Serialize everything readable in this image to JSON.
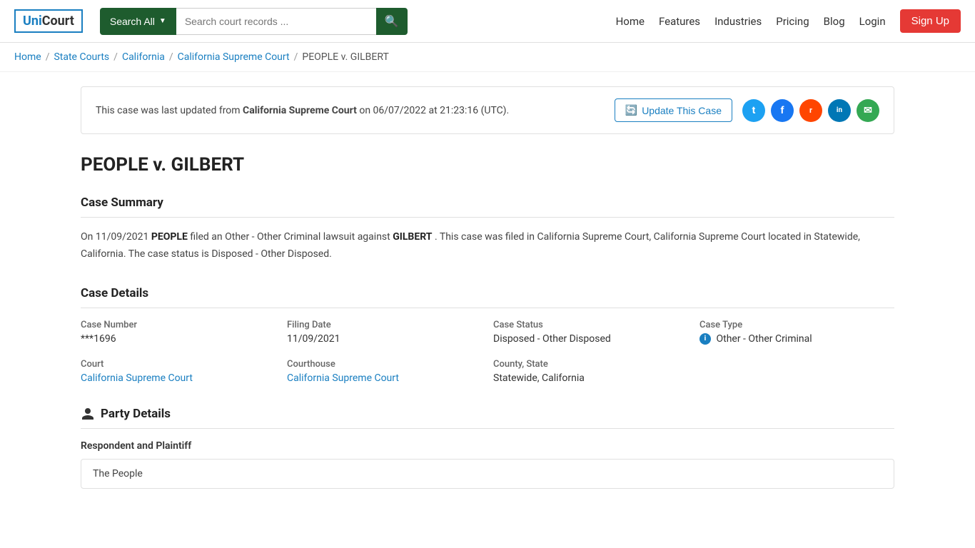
{
  "logo": {
    "uni": "Uni",
    "court": "Court"
  },
  "header": {
    "search_all_label": "Search All",
    "search_placeholder": "Search court records ...",
    "nav": [
      "Home",
      "Features",
      "Industries",
      "Pricing",
      "Blog",
      "Login"
    ],
    "signup_label": "Sign Up"
  },
  "breadcrumb": {
    "items": [
      {
        "label": "Home",
        "href": "#"
      },
      {
        "label": "State Courts",
        "href": "#"
      },
      {
        "label": "California",
        "href": "#"
      },
      {
        "label": "California Supreme Court",
        "href": "#"
      },
      {
        "label": "PEOPLE v. GILBERT",
        "href": null
      }
    ]
  },
  "update_notice": {
    "prefix": "This case was last updated from",
    "court": "California Supreme Court",
    "suffix": "on 06/07/2022 at 21:23:16 (UTC).",
    "btn_label": "Update This Case"
  },
  "social": {
    "icons": [
      {
        "name": "twitter",
        "letter": "t",
        "class": "si-twitter"
      },
      {
        "name": "facebook",
        "letter": "f",
        "class": "si-facebook"
      },
      {
        "name": "reddit",
        "letter": "r",
        "class": "si-reddit"
      },
      {
        "name": "linkedin",
        "letter": "in",
        "class": "si-linkedin"
      },
      {
        "name": "email",
        "letter": "✉",
        "class": "si-email"
      }
    ]
  },
  "case": {
    "title": "PEOPLE v. GILBERT",
    "summary_section": "Case Summary",
    "summary_text_prefix": "On 11/09/2021",
    "plaintiff": "PEOPLE",
    "summary_middle": "filed an Other - Other Criminal lawsuit against",
    "defendant": "GILBERT",
    "summary_suffix": ". This case was filed in California Supreme Court, California Supreme Court located in Statewide, California. The case status is Disposed - Other Disposed.",
    "details_section": "Case Details",
    "details": {
      "case_number_label": "Case Number",
      "case_number_value": "***1696",
      "filing_date_label": "Filing Date",
      "filing_date_value": "11/09/2021",
      "case_status_label": "Case Status",
      "case_status_value": "Disposed - Other Disposed",
      "case_type_label": "Case Type",
      "case_type_value": "Other - Other Criminal",
      "court_label": "Court",
      "court_value": "California Supreme Court",
      "courthouse_label": "Courthouse",
      "courthouse_value": "California Supreme Court",
      "county_state_label": "County, State",
      "county_state_value": "Statewide, California"
    },
    "party_section": "Party Details",
    "respondent_label": "Respondent and Plaintiff",
    "party_name": "The People"
  }
}
